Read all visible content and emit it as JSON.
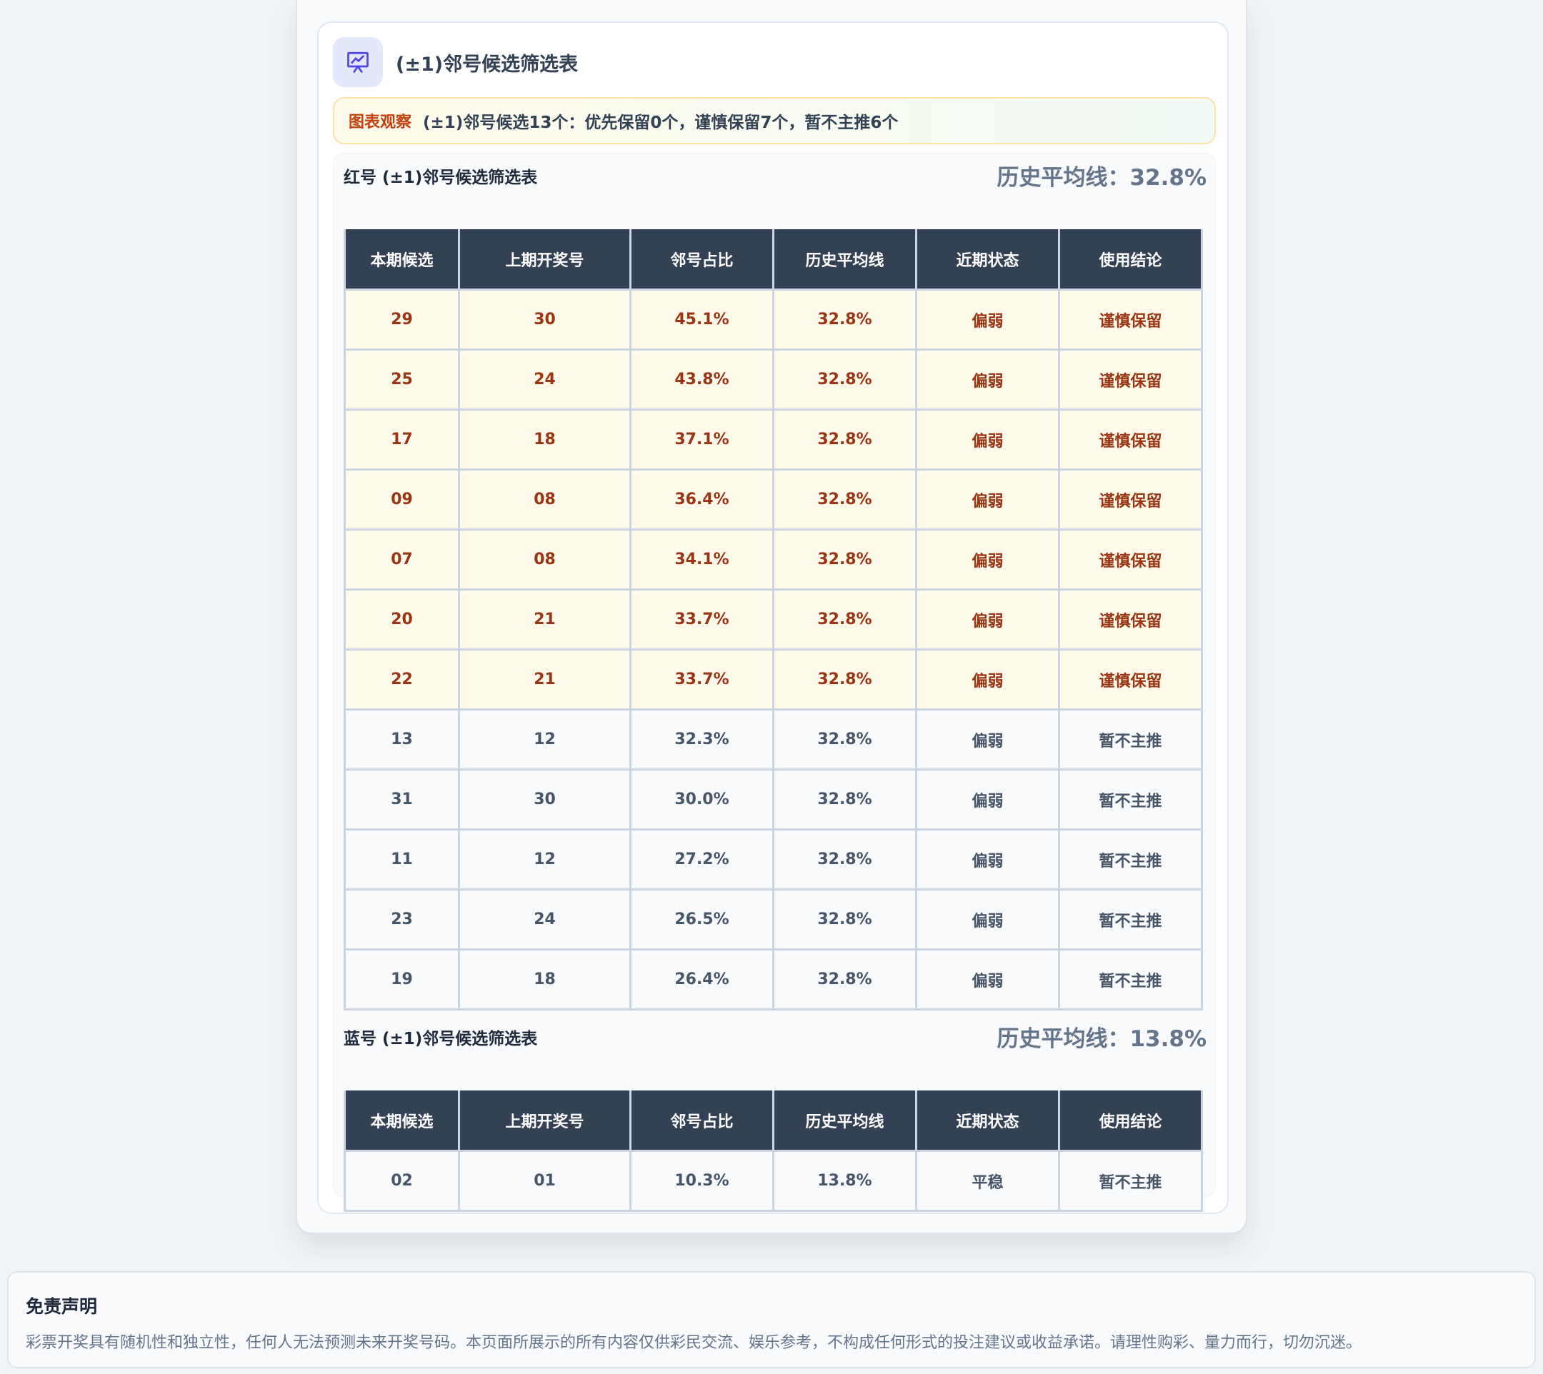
{
  "card": {
    "title": "(±1)邻号候选筛选表",
    "icon": "presentation-chart-icon"
  },
  "observation": {
    "label": "图表观察",
    "text": "(±1)邻号候选13个：优先保留0个，谨慎保留7个，暂不主推6个"
  },
  "columns": [
    "本期候选",
    "上期开奖号",
    "邻号占比",
    "历史平均线",
    "近期状态",
    "使用结论"
  ],
  "red": {
    "title": "红号 (±1)邻号候选筛选表",
    "avg_label": "历史平均线：32.8%",
    "rows": [
      {
        "candidate": "29",
        "last": "30",
        "ratio": "45.1%",
        "avg": "32.8%",
        "status": "偏弱",
        "conclusion": "谨慎保留",
        "kind": "cautious"
      },
      {
        "candidate": "25",
        "last": "24",
        "ratio": "43.8%",
        "avg": "32.8%",
        "status": "偏弱",
        "conclusion": "谨慎保留",
        "kind": "cautious"
      },
      {
        "candidate": "17",
        "last": "18",
        "ratio": "37.1%",
        "avg": "32.8%",
        "status": "偏弱",
        "conclusion": "谨慎保留",
        "kind": "cautious"
      },
      {
        "candidate": "09",
        "last": "08",
        "ratio": "36.4%",
        "avg": "32.8%",
        "status": "偏弱",
        "conclusion": "谨慎保留",
        "kind": "cautious"
      },
      {
        "candidate": "07",
        "last": "08",
        "ratio": "34.1%",
        "avg": "32.8%",
        "status": "偏弱",
        "conclusion": "谨慎保留",
        "kind": "cautious"
      },
      {
        "candidate": "20",
        "last": "21",
        "ratio": "33.7%",
        "avg": "32.8%",
        "status": "偏弱",
        "conclusion": "谨慎保留",
        "kind": "cautious"
      },
      {
        "candidate": "22",
        "last": "21",
        "ratio": "33.7%",
        "avg": "32.8%",
        "status": "偏弱",
        "conclusion": "谨慎保留",
        "kind": "cautious"
      },
      {
        "candidate": "13",
        "last": "12",
        "ratio": "32.3%",
        "avg": "32.8%",
        "status": "偏弱",
        "conclusion": "暂不主推",
        "kind": "normal"
      },
      {
        "candidate": "31",
        "last": "30",
        "ratio": "30.0%",
        "avg": "32.8%",
        "status": "偏弱",
        "conclusion": "暂不主推",
        "kind": "normal"
      },
      {
        "candidate": "11",
        "last": "12",
        "ratio": "27.2%",
        "avg": "32.8%",
        "status": "偏弱",
        "conclusion": "暂不主推",
        "kind": "normal"
      },
      {
        "candidate": "23",
        "last": "24",
        "ratio": "26.5%",
        "avg": "32.8%",
        "status": "偏弱",
        "conclusion": "暂不主推",
        "kind": "normal"
      },
      {
        "candidate": "19",
        "last": "18",
        "ratio": "26.4%",
        "avg": "32.8%",
        "status": "偏弱",
        "conclusion": "暂不主推",
        "kind": "normal"
      }
    ]
  },
  "blue": {
    "title": "蓝号 (±1)邻号候选筛选表",
    "avg_label": "历史平均线：13.8%",
    "rows": [
      {
        "candidate": "02",
        "last": "01",
        "ratio": "10.3%",
        "avg": "13.8%",
        "status": "平稳",
        "conclusion": "暂不主推",
        "kind": "normal"
      }
    ]
  },
  "disclaimer": {
    "title": "免责声明",
    "text": "彩票开奖具有随机性和独立性，任何人无法预测未来开奖号码。本页面所展示的所有内容仅供彩民交流、娱乐参考，不构成任何形式的投注建议或收益承诺。请理性购彩、量力而行，切勿沉迷。"
  },
  "colors": {
    "header_bg": "#334155",
    "cautious_bg": "#fffbea",
    "cautious_text": "#9a3412",
    "observation_label": "#c2410c",
    "icon_bg": "#e3e8fb",
    "icon_stroke": "#4f46e5"
  }
}
